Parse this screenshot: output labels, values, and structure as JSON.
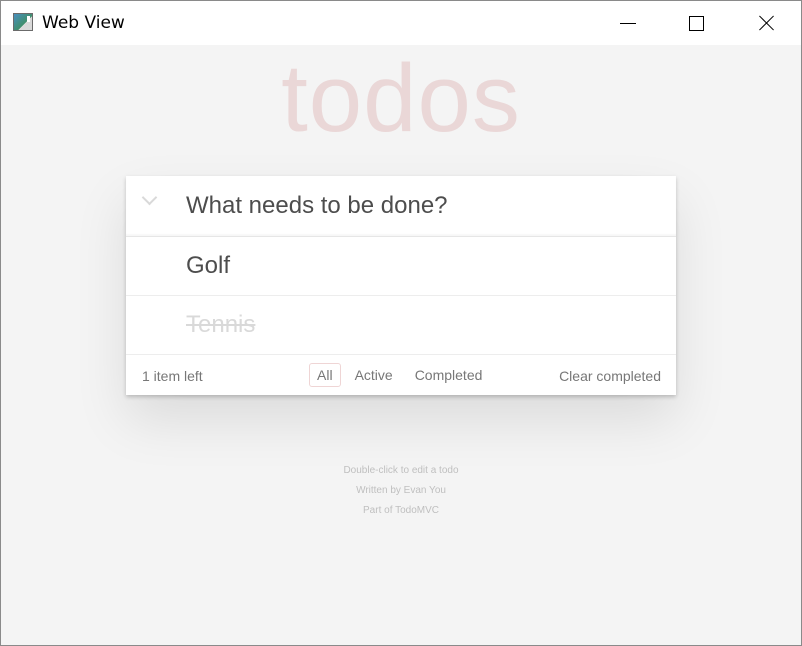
{
  "window": {
    "title": "Web View",
    "icons": {
      "app": "web-view-icon",
      "minimize": "minimize-icon",
      "maximize": "maximize-icon",
      "close": "close-icon"
    }
  },
  "app": {
    "title": "todos",
    "title_color": "#ead7d7",
    "new_todo_placeholder": "What needs to be done?",
    "new_todo_value": "",
    "todos": [
      {
        "label": "Golf",
        "completed": false
      },
      {
        "label": "Tennis",
        "completed": true
      }
    ],
    "footer": {
      "count_text": "1 item left",
      "filters": [
        {
          "label": "All",
          "selected": true
        },
        {
          "label": "Active",
          "selected": false
        },
        {
          "label": "Completed",
          "selected": false
        }
      ],
      "clear_completed_label": "Clear completed"
    },
    "info": {
      "line1": "Double-click to edit a todo",
      "line2": "Written by Evan You",
      "line3": "Part of TodoMVC"
    }
  }
}
